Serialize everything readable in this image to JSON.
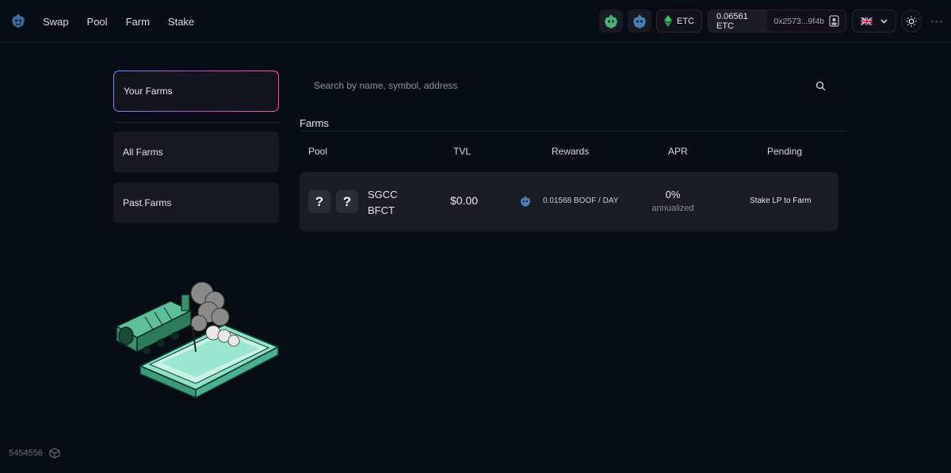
{
  "nav": {
    "items": [
      "Swap",
      "Pool",
      "Farm",
      "Stake"
    ]
  },
  "header": {
    "network": "ETC",
    "balance": "0.06561 ETC",
    "address": "0x2573...9f4b",
    "language_flag": "🇬🇧",
    "more": "···"
  },
  "sidebar": {
    "items": [
      "Your Farms",
      "All Farms",
      "Past Farms"
    ],
    "active": "Your Farms"
  },
  "search": {
    "placeholder": "Search by name, symbol, address",
    "value": ""
  },
  "farms": {
    "title": "Farms",
    "columns": [
      "Pool",
      "TVL",
      "Rewards",
      "APR",
      "Pending"
    ],
    "rows": [
      {
        "token_a_icon": "?",
        "token_b_icon": "?",
        "token_a": "SGCC",
        "token_b": "BFCT",
        "tvl": "$0.00",
        "rewards": "0.01568 BOOF / DAY",
        "apr": "0%",
        "apr_note": "annualized",
        "pending": "Stake LP to Farm"
      }
    ]
  },
  "footer": {
    "block_number": "5454556"
  },
  "colors": {
    "background": "#080c14",
    "accent_pink": "#ff5aa0",
    "accent_blue": "#6b8cff",
    "mascot_green": "#4bb07a"
  }
}
